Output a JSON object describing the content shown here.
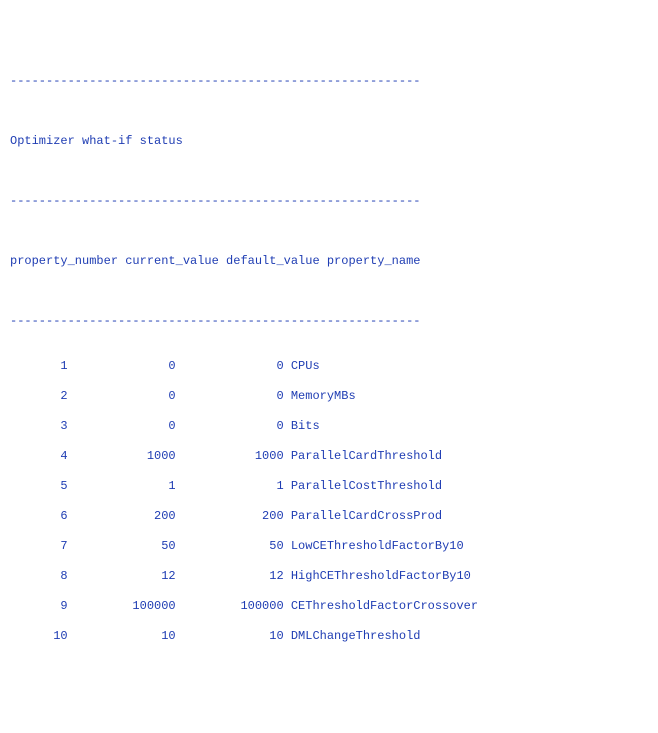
{
  "separator": "---------------------------------------------------------",
  "title": "Optimizer what-if status",
  "header": "property_number current_value default_value property_name",
  "columns": {
    "property_number": "property_number",
    "current_value": "current_value",
    "default_value": "default_value",
    "property_name": "property_name"
  },
  "rows": [
    {
      "property_number": 1,
      "current_value": 0,
      "default_value": 0,
      "property_name": "CPUs"
    },
    {
      "property_number": 2,
      "current_value": 0,
      "default_value": 0,
      "property_name": "MemoryMBs"
    },
    {
      "property_number": 3,
      "current_value": 0,
      "default_value": 0,
      "property_name": "Bits"
    },
    {
      "property_number": 4,
      "current_value": 1000,
      "default_value": 1000,
      "property_name": "ParallelCardThreshold"
    },
    {
      "property_number": 5,
      "current_value": 1,
      "default_value": 1,
      "property_name": "ParallelCostThreshold"
    },
    {
      "property_number": 6,
      "current_value": 200,
      "default_value": 200,
      "property_name": "ParallelCardCrossProd"
    },
    {
      "property_number": 7,
      "current_value": 50,
      "default_value": 50,
      "property_name": "LowCEThresholdFactorBy10"
    },
    {
      "property_number": 8,
      "current_value": 12,
      "default_value": 12,
      "property_name": "HighCEThresholdFactorBy10"
    },
    {
      "property_number": 9,
      "current_value": 100000,
      "default_value": 100000,
      "property_name": "CEThresholdFactorCrossover"
    },
    {
      "property_number": 10,
      "current_value": 10,
      "default_value": 10,
      "property_name": "DMLChangeThreshold"
    }
  ]
}
